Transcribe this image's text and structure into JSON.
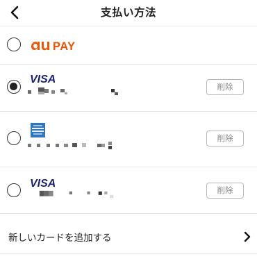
{
  "header": {
    "title": "支払い方法"
  },
  "methods": [
    {
      "brand": "au PAY",
      "selected": false
    },
    {
      "brand": "VISA",
      "selected": true,
      "delete_label": "削除"
    },
    {
      "brand": "AMEX",
      "selected": false,
      "delete_label": "削除"
    },
    {
      "brand": "VISA",
      "selected": false,
      "delete_label": "削除"
    }
  ],
  "add_card": {
    "label": "新しいカードを追加する"
  },
  "colors": {
    "au_orange": "#eb5505",
    "visa_navy": "#1a1f71",
    "amex_blue": "#2e77bb"
  }
}
